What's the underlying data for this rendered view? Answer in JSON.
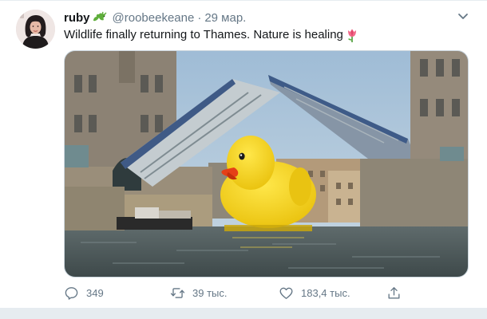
{
  "user": {
    "display_name": "ruby",
    "handle": "@roobeekeane",
    "separator": "·",
    "time": "29 мар.",
    "avatar_icon": "profile-photo",
    "badge_icon": "dragon-emoji-icon"
  },
  "tweet": {
    "text": "Wildlife finally returning to Thames. Nature is healing",
    "emoji_icon": "tulip-emoji-icon"
  },
  "media": {
    "type": "photo",
    "subject": "giant-yellow-rubber-duck-tower-bridge"
  },
  "actions": {
    "reply_count": "349",
    "retweet_count": "39 тыс.",
    "like_count": "183,4 тыс.",
    "share_icon": "share-icon"
  },
  "colors": {
    "text": "#14171a",
    "secondary": "#657786",
    "border": "#e6ecf0",
    "duck": "#f7d51d",
    "beak": "#e8421a"
  }
}
